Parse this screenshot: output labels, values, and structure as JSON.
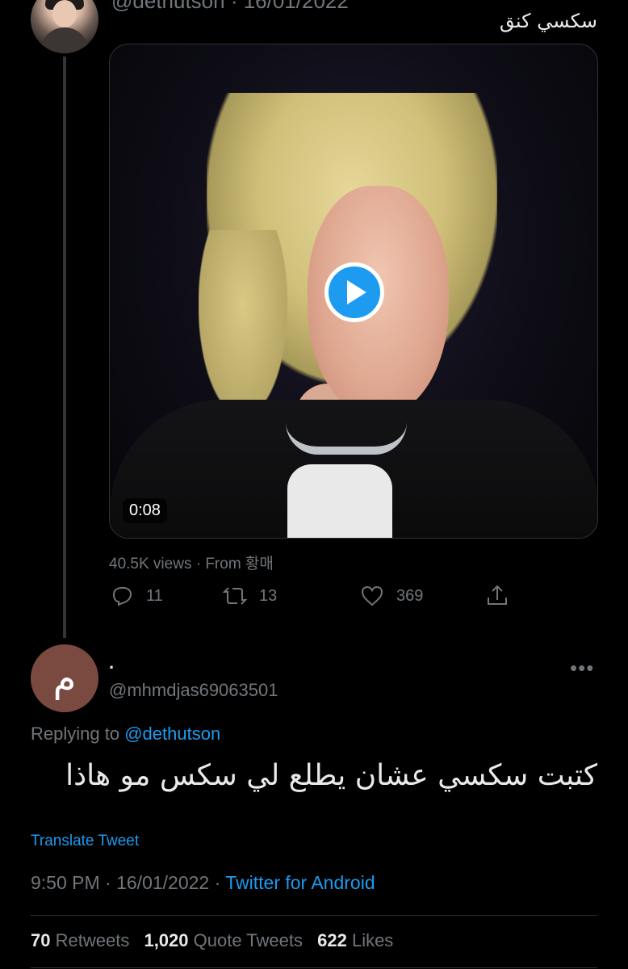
{
  "parent_tweet": {
    "meta_text": "@dethutson · 16/01/2022",
    "text": "سكسي كنق",
    "media": {
      "duration": "0:08",
      "views_text": "40.5K views · From 황매"
    },
    "actions": {
      "reply_count": "11",
      "retweet_count": "13",
      "like_count": "369"
    }
  },
  "tweet": {
    "avatar_letter": "م",
    "avatar_color": "#7a4a41",
    "display_name": "·",
    "handle": "@mhmdjas69063501",
    "more_label": "•••",
    "replying_prefix": "Replying to",
    "replying_to": "@dethutson",
    "text": "كتبت سكسي عشان يطلع لي سكس مو هاذا",
    "translate_label": "Translate Tweet",
    "time": "9:50 PM · 16/01/2022 ·",
    "source": "Twitter for Android"
  },
  "stats": {
    "retweets_value": "70",
    "retweets_label": "Retweets",
    "quotes_value": "1,020",
    "quotes_label": "Quote Tweets",
    "likes_value": "622",
    "likes_label": "Likes"
  },
  "colors": {
    "accent": "#1d9bf0",
    "background": "#000000",
    "muted": "#71767b"
  }
}
